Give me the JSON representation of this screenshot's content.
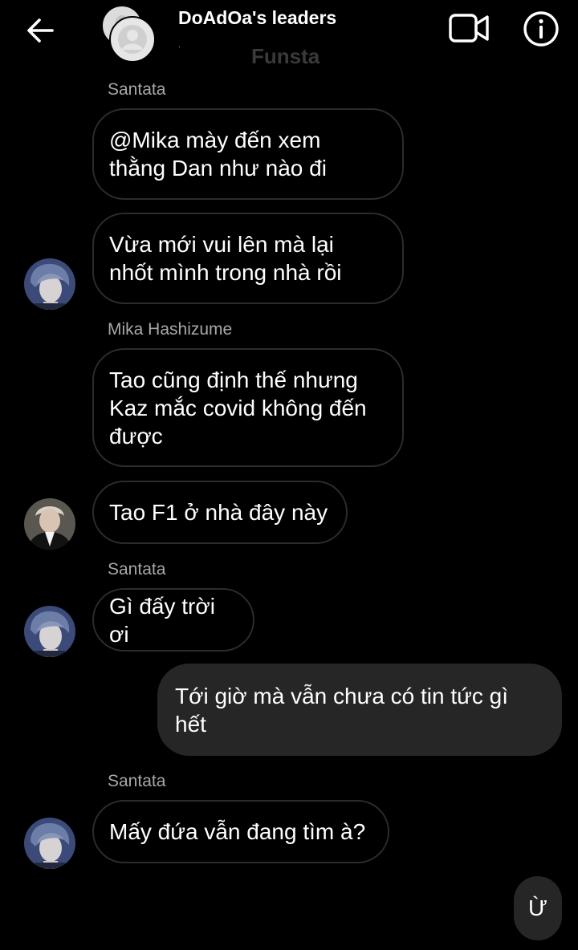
{
  "header": {
    "title": "DoAdOa's leaders",
    "subtitle_dot": ".",
    "subtitle": "Funsta",
    "icons": {
      "back": "arrow-left-icon",
      "video": "video-camera-icon",
      "info": "info-circle-icon",
      "group_avatar": "group-avatar-placeholder"
    }
  },
  "messages": [
    {
      "id": "m1",
      "sender": "Santata",
      "text": "@Mika mày đến xem\nthằng Dan như nào đi",
      "direction": "incoming",
      "show_avatar": false
    },
    {
      "id": "m2",
      "text": "Vừa mới vui lên mà lại\nnhốt mình trong nhà rồi",
      "direction": "incoming",
      "show_avatar": true,
      "avatar": "santata-avatar"
    },
    {
      "id": "m3",
      "sender": "Mika Hashizume",
      "text": "Tao cũng định thế nhưng\nKaz mắc covid không đến\nđược",
      "direction": "incoming",
      "show_avatar": false
    },
    {
      "id": "m4",
      "text": "Tao F1 ở nhà đây này",
      "direction": "incoming",
      "show_avatar": true,
      "avatar": "mika-avatar"
    },
    {
      "id": "m5",
      "sender": "Santata",
      "text": "Gì đấy trời ơi",
      "direction": "incoming",
      "show_avatar": true,
      "avatar": "santata-avatar"
    },
    {
      "id": "m6",
      "text": "Tới giờ mà vẫn chưa có tin tức gì\nhết",
      "direction": "outgoing"
    },
    {
      "id": "m7",
      "sender": "Santata",
      "text": "Mấy đứa vẫn đang tìm à?",
      "direction": "incoming",
      "show_avatar": true,
      "avatar": "santata-avatar"
    }
  ],
  "reply": {
    "text": "Ừ"
  },
  "colors": {
    "background": "#000000",
    "incoming_border": "#2c2c2c",
    "outgoing_bubble": "#262626",
    "sender_name": "#a8a8a8",
    "subtitle": "#3a3a3a"
  }
}
